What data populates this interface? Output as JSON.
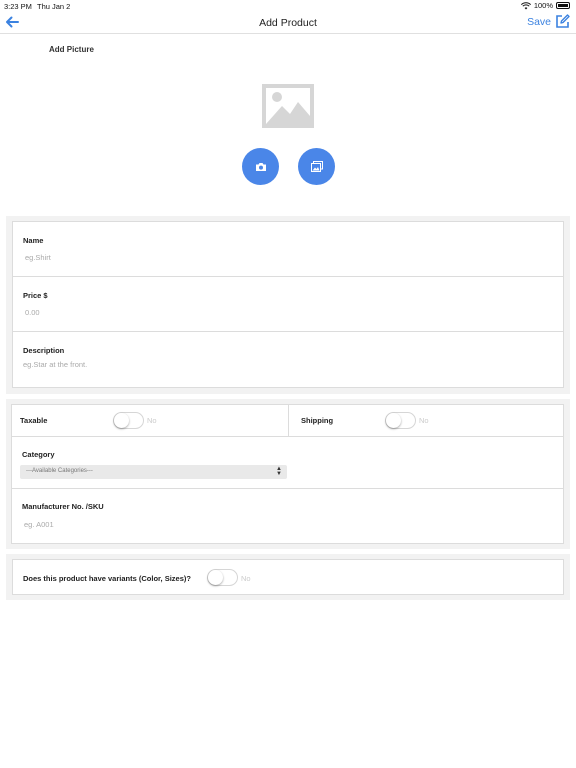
{
  "status_bar": {
    "time": "3:23 PM",
    "date": "Thu Jan 2",
    "battery": "100%"
  },
  "nav": {
    "title": "Add Product",
    "save_label": "Save",
    "back_icon": "arrow-left-icon",
    "edit_icon": "edit-icon"
  },
  "picture": {
    "label": "Add Picture",
    "camera_icon": "camera-icon",
    "gallery_icon": "gallery-icon"
  },
  "fields": {
    "name": {
      "label": "Name",
      "placeholder": "eg.Shirt"
    },
    "price": {
      "label": "Price $",
      "placeholder": "0.00"
    },
    "description": {
      "label": "Description",
      "placeholder": "eg.Star at the front."
    }
  },
  "options": {
    "taxable": {
      "label": "Taxable",
      "state": "No"
    },
    "shipping": {
      "label": "Shipping",
      "state": "No"
    },
    "category": {
      "label": "Category",
      "selected": "---Available Categories---"
    },
    "sku": {
      "label": "Manufacturer No. /SKU",
      "placeholder": "eg. A001"
    }
  },
  "variants": {
    "label": "Does this product have variants (Color, Sizes)?",
    "state": "No"
  },
  "colors": {
    "accent": "#4a86e8",
    "link": "#3b82e0",
    "background_group": "#f2f2f2"
  }
}
